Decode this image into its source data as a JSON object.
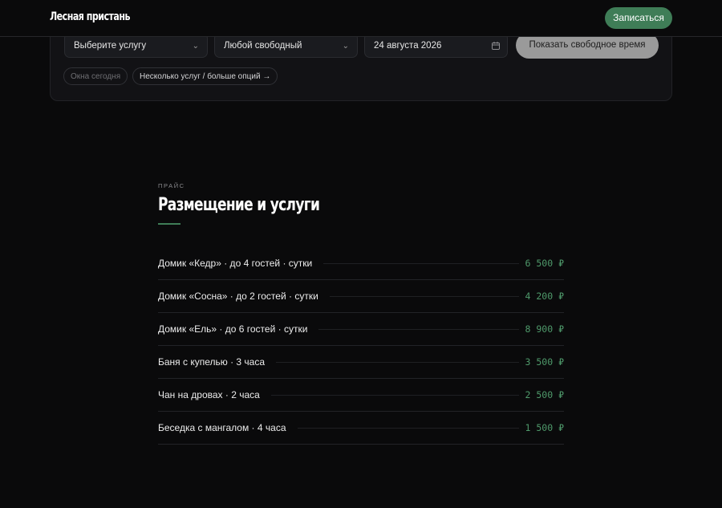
{
  "header": {
    "logo": "Лесная пристань",
    "cta_label": "Записаться"
  },
  "booking": {
    "service_select": "Выберите услугу",
    "specialist_select": "Любой свободный",
    "date_field": "24 августа 2026",
    "show_button": "Показать свободное время",
    "chips": [
      "Окна сегодня",
      "Несколько услуг / больше опций →"
    ]
  },
  "prices": {
    "eyebrow": "ПРАЙС",
    "title": "Размещение и услуги",
    "items": [
      {
        "name": "Домик «Кедр» · до 4 гостей · сутки",
        "price": "6 500 ₽"
      },
      {
        "name": "Домик «Сосна» · до 2 гостей · сутки",
        "price": "4 200 ₽"
      },
      {
        "name": "Домик «Ель» · до 6 гостей · сутки",
        "price": "8 900 ₽"
      },
      {
        "name": "Баня с купелью · 3 часа",
        "price": "3 500 ₽"
      },
      {
        "name": "Чан на дровах · 2 часа",
        "price": "2 500 ₽"
      },
      {
        "name": "Беседка с мангалом · 4 часа",
        "price": "1 500 ₽"
      }
    ]
  },
  "icons": {
    "select_chevron": "chevron-down-icon",
    "date_icon": "calendar-icon",
    "arrow": "arrow-right-icon"
  },
  "colors": {
    "accent": "#3f7d57",
    "price": "#4f9a6b",
    "background": "#0a0a0b",
    "panel": "#121215"
  }
}
